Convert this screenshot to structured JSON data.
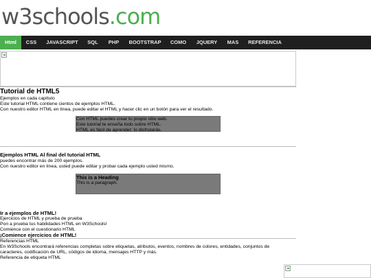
{
  "logo": {
    "prefix": "w3schools",
    "suffix": ".com"
  },
  "nav": [
    {
      "label": "Html",
      "active": true
    },
    {
      "label": "CSS"
    },
    {
      "label": "JAVASCRIPT"
    },
    {
      "label": "SQL"
    },
    {
      "label": "PHP"
    },
    {
      "label": "BOOTSTRAP"
    },
    {
      "label": "COMO"
    },
    {
      "label": "JQUERY"
    },
    {
      "label": "MAS"
    },
    {
      "label": "REFERENCIA"
    }
  ],
  "tutorial": {
    "title": "Tutorial de HTML5",
    "lines": [
      "Ejemplos en cada capítulo",
      "Este tutorial HTML contiene cientos de ejemplos HTML.",
      "Con nuestro editor HTML en línea, puede editar el HTML y hacer clic en un botón para ver el resultado."
    ],
    "box_lines": [
      "Con HTML puedes crear tu propio sitio web.",
      "Este tutorial te enseña todo sobre HTML.",
      "HTML es fácil de aprender: lo disfrutarás."
    ]
  },
  "examples": {
    "title": "Ejemplos HTML Al final del tutorial HTML",
    "lines": [
      "puedes encontrar más de 200 ejemplos.",
      "Con nuestro editor en línea, usted puede editar y probar cada ejemplo usted mismo."
    ],
    "box_heading": "This is a Heading",
    "box_para": "This is a paragraph."
  },
  "goto": {
    "title": "Ir a ejemplos de HTML!",
    "lines": [
      "Ejercicios de HTML y prueba de prueba",
      "Pon a prueba tus habilidades HTML en W3Schools!",
      "Comience con el cuestionario HTML"
    ]
  },
  "exercises": {
    "title": "¡Comience ejercicios de HTML!"
  },
  "references": {
    "lines": [
      "Referencias HTML",
      "En W3Schools encontrará referencias completas sobre etiquetas, atributos, eventos, nombres de colores, entidades, conjuntos de",
      "caracteres, codificación de URL, códigos de idioma, mensajes HTTP y más.",
      "Referencia de etiqueta HTML"
    ]
  }
}
